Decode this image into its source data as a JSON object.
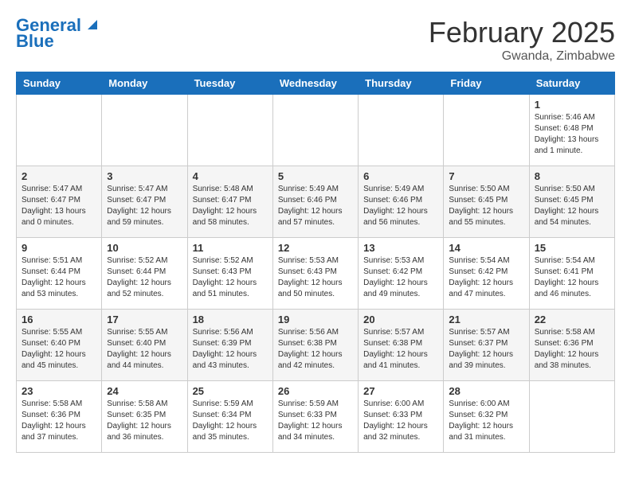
{
  "header": {
    "logo_line1": "General",
    "logo_line2": "Blue",
    "month_title": "February 2025",
    "location": "Gwanda, Zimbabwe"
  },
  "days_of_week": [
    "Sunday",
    "Monday",
    "Tuesday",
    "Wednesday",
    "Thursday",
    "Friday",
    "Saturday"
  ],
  "weeks": [
    [
      {
        "day": "",
        "info": ""
      },
      {
        "day": "",
        "info": ""
      },
      {
        "day": "",
        "info": ""
      },
      {
        "day": "",
        "info": ""
      },
      {
        "day": "",
        "info": ""
      },
      {
        "day": "",
        "info": ""
      },
      {
        "day": "1",
        "info": "Sunrise: 5:46 AM\nSunset: 6:48 PM\nDaylight: 13 hours\nand 1 minute."
      }
    ],
    [
      {
        "day": "2",
        "info": "Sunrise: 5:47 AM\nSunset: 6:47 PM\nDaylight: 13 hours\nand 0 minutes."
      },
      {
        "day": "3",
        "info": "Sunrise: 5:47 AM\nSunset: 6:47 PM\nDaylight: 12 hours\nand 59 minutes."
      },
      {
        "day": "4",
        "info": "Sunrise: 5:48 AM\nSunset: 6:47 PM\nDaylight: 12 hours\nand 58 minutes."
      },
      {
        "day": "5",
        "info": "Sunrise: 5:49 AM\nSunset: 6:46 PM\nDaylight: 12 hours\nand 57 minutes."
      },
      {
        "day": "6",
        "info": "Sunrise: 5:49 AM\nSunset: 6:46 PM\nDaylight: 12 hours\nand 56 minutes."
      },
      {
        "day": "7",
        "info": "Sunrise: 5:50 AM\nSunset: 6:45 PM\nDaylight: 12 hours\nand 55 minutes."
      },
      {
        "day": "8",
        "info": "Sunrise: 5:50 AM\nSunset: 6:45 PM\nDaylight: 12 hours\nand 54 minutes."
      }
    ],
    [
      {
        "day": "9",
        "info": "Sunrise: 5:51 AM\nSunset: 6:44 PM\nDaylight: 12 hours\nand 53 minutes."
      },
      {
        "day": "10",
        "info": "Sunrise: 5:52 AM\nSunset: 6:44 PM\nDaylight: 12 hours\nand 52 minutes."
      },
      {
        "day": "11",
        "info": "Sunrise: 5:52 AM\nSunset: 6:43 PM\nDaylight: 12 hours\nand 51 minutes."
      },
      {
        "day": "12",
        "info": "Sunrise: 5:53 AM\nSunset: 6:43 PM\nDaylight: 12 hours\nand 50 minutes."
      },
      {
        "day": "13",
        "info": "Sunrise: 5:53 AM\nSunset: 6:42 PM\nDaylight: 12 hours\nand 49 minutes."
      },
      {
        "day": "14",
        "info": "Sunrise: 5:54 AM\nSunset: 6:42 PM\nDaylight: 12 hours\nand 47 minutes."
      },
      {
        "day": "15",
        "info": "Sunrise: 5:54 AM\nSunset: 6:41 PM\nDaylight: 12 hours\nand 46 minutes."
      }
    ],
    [
      {
        "day": "16",
        "info": "Sunrise: 5:55 AM\nSunset: 6:40 PM\nDaylight: 12 hours\nand 45 minutes."
      },
      {
        "day": "17",
        "info": "Sunrise: 5:55 AM\nSunset: 6:40 PM\nDaylight: 12 hours\nand 44 minutes."
      },
      {
        "day": "18",
        "info": "Sunrise: 5:56 AM\nSunset: 6:39 PM\nDaylight: 12 hours\nand 43 minutes."
      },
      {
        "day": "19",
        "info": "Sunrise: 5:56 AM\nSunset: 6:38 PM\nDaylight: 12 hours\nand 42 minutes."
      },
      {
        "day": "20",
        "info": "Sunrise: 5:57 AM\nSunset: 6:38 PM\nDaylight: 12 hours\nand 41 minutes."
      },
      {
        "day": "21",
        "info": "Sunrise: 5:57 AM\nSunset: 6:37 PM\nDaylight: 12 hours\nand 39 minutes."
      },
      {
        "day": "22",
        "info": "Sunrise: 5:58 AM\nSunset: 6:36 PM\nDaylight: 12 hours\nand 38 minutes."
      }
    ],
    [
      {
        "day": "23",
        "info": "Sunrise: 5:58 AM\nSunset: 6:36 PM\nDaylight: 12 hours\nand 37 minutes."
      },
      {
        "day": "24",
        "info": "Sunrise: 5:58 AM\nSunset: 6:35 PM\nDaylight: 12 hours\nand 36 minutes."
      },
      {
        "day": "25",
        "info": "Sunrise: 5:59 AM\nSunset: 6:34 PM\nDaylight: 12 hours\nand 35 minutes."
      },
      {
        "day": "26",
        "info": "Sunrise: 5:59 AM\nSunset: 6:33 PM\nDaylight: 12 hours\nand 34 minutes."
      },
      {
        "day": "27",
        "info": "Sunrise: 6:00 AM\nSunset: 6:33 PM\nDaylight: 12 hours\nand 32 minutes."
      },
      {
        "day": "28",
        "info": "Sunrise: 6:00 AM\nSunset: 6:32 PM\nDaylight: 12 hours\nand 31 minutes."
      },
      {
        "day": "",
        "info": ""
      }
    ]
  ]
}
